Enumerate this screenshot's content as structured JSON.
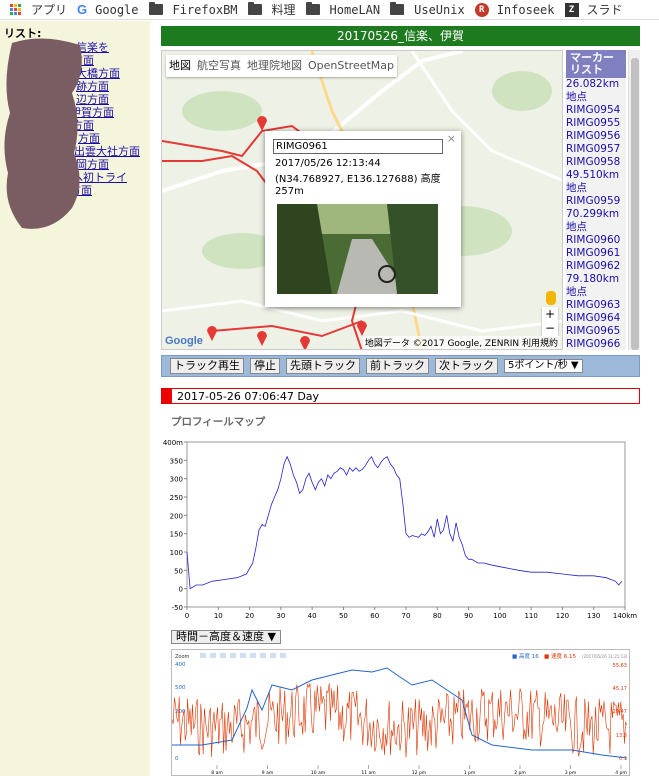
{
  "bookmarks": [
    {
      "label": "アプリ",
      "icon": "apps-icon"
    },
    {
      "label": "Google",
      "icon": "google-icon"
    },
    {
      "label": "FirefoxBM",
      "icon": "folder-icon"
    },
    {
      "label": "料理",
      "icon": "folder-icon"
    },
    {
      "label": "HomeLAN",
      "icon": "folder-icon"
    },
    {
      "label": "UseUnix",
      "icon": "folder-icon"
    },
    {
      "label": "Infoseek",
      "icon": "infoseek-icon"
    },
    {
      "label": "スラド",
      "icon": "slashdot-icon"
    }
  ],
  "sidebar": {
    "title": "リスト:",
    "links": [
      "信楽を",
      "方面",
      "大橋方面",
      "跡方面",
      "辺方面",
      "伊賀方面",
      "方面",
      "方面",
      "出雲大社方面",
      "岡方面",
      "へ初トライ",
      "方面"
    ]
  },
  "page": {
    "title": "20170526_信楽、伊賀"
  },
  "map": {
    "tabs": [
      "地図",
      "航空写真",
      "地理院地図",
      "OpenStreetMap"
    ],
    "popup": {
      "name": "RIMG0961",
      "date": "2017/05/26 12:13:44",
      "geo": "(N34.768927, E136.127688) 高度 257m",
      "close": "×"
    },
    "google": "Google",
    "attribution": "地図データ ©2017 Google, ZENRIN  利用規約",
    "zoom_in": "+",
    "zoom_out": "−"
  },
  "markers": {
    "header": "マーカーリスト",
    "items": [
      "26.082km地点",
      "RIMG0954",
      "RIMG0955",
      "RIMG0956",
      "RIMG0957",
      "RIMG0958",
      "49.510km地点",
      "RIMG0959",
      "70.299km地点",
      "RIMG0960",
      "RIMG0961",
      "RIMG0962",
      "79.180km地点",
      "RIMG0963",
      "RIMG0964",
      "RIMG0965",
      "RIMG0966"
    ]
  },
  "toolbar": {
    "play": "トラック再生",
    "stop": "停止",
    "first": "先頭トラック",
    "prev": "前トラック",
    "next": "次トラック",
    "speed": "5ポイント/秒 ▼"
  },
  "track": {
    "date_label": "2017-05-26 07:06:47 Day"
  },
  "profile": {
    "heading": "プロフィールマップ",
    "select": "時間－高度＆速度 ▼"
  },
  "colors": {
    "title_bg": "#1e7a1e",
    "line": "#2222cc",
    "speed": "#dd3300",
    "sidebar_bg": "#f5f5dc",
    "toolbar_bg": "#9cb9d9"
  },
  "chart_data": [
    {
      "type": "line",
      "title": "プロフィールマップ",
      "xlabel": "",
      "ylabel": "",
      "xlim": [
        0,
        140
      ],
      "ylim": [
        -50,
        400
      ],
      "x_unit": "km",
      "y_unit": "m",
      "x_ticks": [
        "0",
        "10",
        "20",
        "30",
        "40",
        "50",
        "60",
        "70",
        "80",
        "90",
        "100",
        "110",
        "120",
        "130",
        "140km"
      ],
      "y_ticks": [
        "-50",
        "0",
        "50",
        "100",
        "150",
        "200",
        "250",
        "300",
        "350",
        "400m"
      ],
      "series": [
        {
          "values": [
            [
              0,
              100
            ],
            [
              1,
              0
            ],
            [
              3,
              10
            ],
            [
              5,
              10
            ],
            [
              8,
              20
            ],
            [
              12,
              25
            ],
            [
              16,
              30
            ],
            [
              19,
              40
            ],
            [
              21,
              70
            ],
            [
              22,
              110
            ],
            [
              23,
              160
            ],
            [
              24,
              175
            ],
            [
              25,
              170
            ],
            [
              26,
              200
            ],
            [
              27,
              230
            ],
            [
              28,
              250
            ],
            [
              29,
              270
            ],
            [
              30,
              300
            ],
            [
              31,
              340
            ],
            [
              32,
              360
            ],
            [
              33,
              340
            ],
            [
              34,
              310
            ],
            [
              35,
              290
            ],
            [
              36,
              260
            ],
            [
              37,
              270
            ],
            [
              38,
              300
            ],
            [
              39,
              315
            ],
            [
              40,
              290
            ],
            [
              41,
              270
            ],
            [
              42,
              290
            ],
            [
              43,
              300
            ],
            [
              44,
              280
            ],
            [
              45,
              310
            ],
            [
              46,
              300
            ],
            [
              47,
              315
            ],
            [
              48,
              320
            ],
            [
              49,
              330
            ],
            [
              50,
              325
            ],
            [
              51,
              310
            ],
            [
              52,
              330
            ],
            [
              53,
              320
            ],
            [
              54,
              330
            ],
            [
              55,
              320
            ],
            [
              56,
              325
            ],
            [
              57,
              335
            ],
            [
              58,
              350
            ],
            [
              59,
              360
            ],
            [
              60,
              340
            ],
            [
              61,
              330
            ],
            [
              62,
              345
            ],
            [
              63,
              355
            ],
            [
              64,
              360
            ],
            [
              65,
              340
            ],
            [
              66,
              330
            ],
            [
              67,
              310
            ],
            [
              68,
              300
            ],
            [
              69,
              230
            ],
            [
              70,
              150
            ],
            [
              71,
              140
            ],
            [
              72,
              145
            ],
            [
              74,
              140
            ],
            [
              75,
              150
            ],
            [
              76,
              145
            ],
            [
              77,
              155
            ],
            [
              78,
              170
            ],
            [
              79,
              140
            ],
            [
              80,
              190
            ],
            [
              81,
              150
            ],
            [
              82,
              160
            ],
            [
              83,
              200
            ],
            [
              84,
              150
            ],
            [
              85,
              130
            ],
            [
              86,
              180
            ],
            [
              87,
              140
            ],
            [
              88,
              120
            ],
            [
              89,
              90
            ],
            [
              90,
              80
            ],
            [
              91,
              80
            ],
            [
              93,
              70
            ],
            [
              95,
              70
            ],
            [
              97,
              65
            ],
            [
              100,
              60
            ],
            [
              103,
              55
            ],
            [
              106,
              50
            ],
            [
              110,
              45
            ],
            [
              115,
              45
            ],
            [
              120,
              40
            ],
            [
              125,
              35
            ],
            [
              130,
              35
            ],
            [
              134,
              30
            ],
            [
              137,
              20
            ],
            [
              138,
              10
            ],
            [
              139,
              20
            ]
          ]
        }
      ]
    },
    {
      "type": "line",
      "title": "",
      "ylim": [
        0,
        400
      ],
      "legend_position": "top-right",
      "legend": [
        {
          "label": "高度",
          "value": "16",
          "color": "#2266cc"
        },
        {
          "label": "速度",
          "value": "6.15",
          "color": "#dd3300"
        }
      ],
      "zoom_label": "Zoom",
      "timestamp": "2017/05/26 11:21:13",
      "left_ticks": [
        "400",
        "500",
        "200",
        "0"
      ],
      "right_ticks": [
        "55.63",
        "45.17",
        "29.47",
        "13.3",
        "0.1"
      ],
      "x_ticks": [
        "8 am",
        "9 am",
        "10 am",
        "11 am",
        "12 pm",
        "1 pm",
        "2 pm",
        "3 pm",
        "4 pm"
      ]
    }
  ]
}
